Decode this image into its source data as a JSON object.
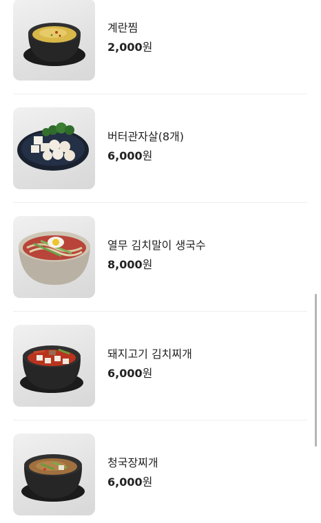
{
  "menu": {
    "items": [
      {
        "name": "계란찜",
        "price": "2,000",
        "currency": "원",
        "image_icon": "steamed-egg-dish-icon"
      },
      {
        "name": "버터관자살(8개)",
        "price": "6,000",
        "currency": "원",
        "image_icon": "butter-scallop-dish-icon"
      },
      {
        "name": "열무 김치말이 생국수",
        "price": "8,000",
        "currency": "원",
        "image_icon": "cold-noodle-dish-icon"
      },
      {
        "name": "돼지고기 김치찌개",
        "price": "6,000",
        "currency": "원",
        "image_icon": "kimchi-stew-dish-icon"
      },
      {
        "name": "청국장찌개",
        "price": "6,000",
        "currency": "원",
        "image_icon": "cheonggukjang-stew-dish-icon"
      }
    ]
  },
  "colors": {
    "text": "#222222",
    "divider": "#eeeeee",
    "scrollbar": "#b5b5b5"
  }
}
